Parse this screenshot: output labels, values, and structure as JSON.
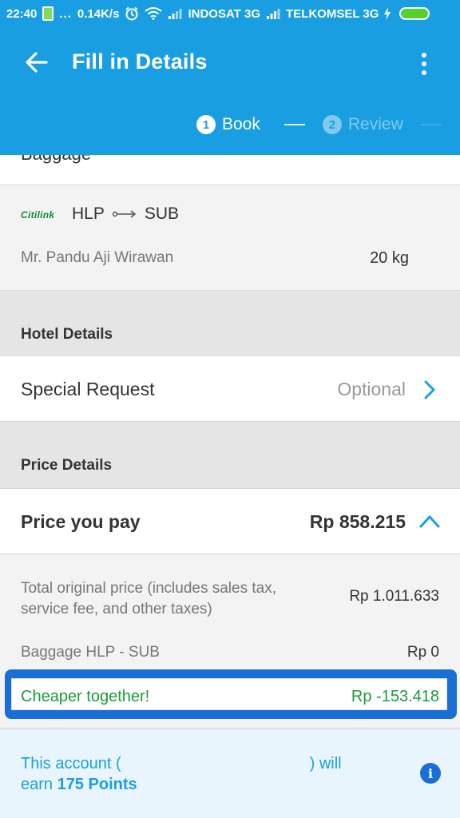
{
  "status_bar": {
    "time": "22:40",
    "dots": "...",
    "speed": "0.14K/s",
    "carrier1": "INDOSAT 3G",
    "carrier2": "TELKOMSEL 3G"
  },
  "header": {
    "title": "Fill in Details",
    "steps": [
      {
        "num": "1",
        "label": "Book"
      },
      {
        "num": "2",
        "label": "Review"
      }
    ]
  },
  "baggage": {
    "section_title": "Baggage",
    "airline": "Citilink",
    "origin": "HLP",
    "destination": "SUB",
    "passenger": "Mr. Pandu Aji Wirawan",
    "weight": "20 kg"
  },
  "hotel": {
    "section_title": "Hotel Details",
    "special_request_label": "Special Request",
    "special_request_value": "Optional"
  },
  "price": {
    "section_title": "Price Details",
    "pay_label": "Price you pay",
    "pay_amount": "Rp 858.215",
    "original_label": "Total original price (includes sales tax, service fee, and other taxes)",
    "original_amount": "Rp 1.011.633",
    "baggage_label": "Baggage HLP - SUB",
    "baggage_amount": "Rp 0",
    "discount_label": "Cheaper together!",
    "discount_amount": "Rp -153.418"
  },
  "points": {
    "prefix": "This account (",
    "suffix": ") will",
    "earn": "earn",
    "points": "175 Points"
  },
  "colors": {
    "primary": "#1a9ee2",
    "highlight": "#1a6fd6",
    "discount": "#1b9c3a",
    "airline_logo": "#0d8a2e"
  }
}
